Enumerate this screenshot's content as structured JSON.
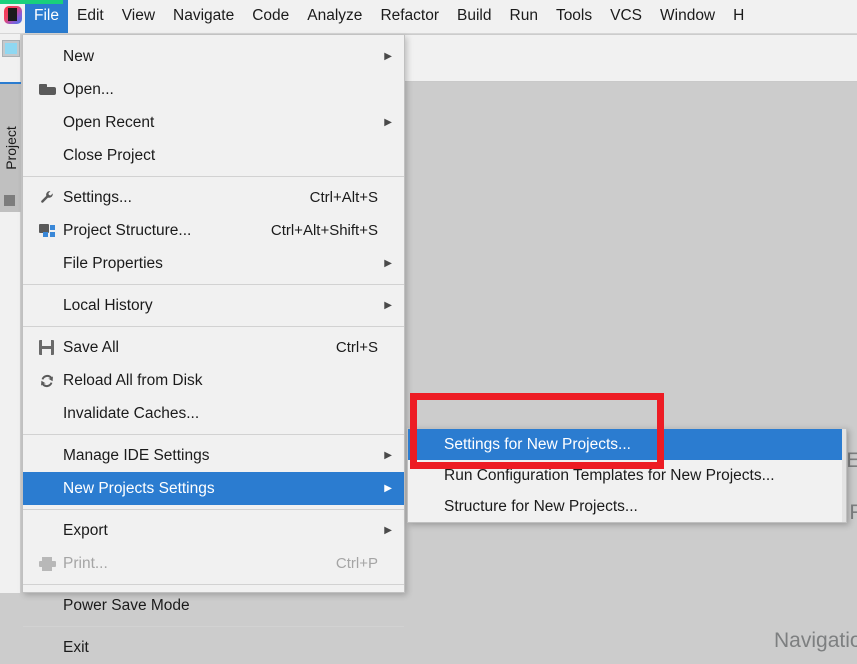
{
  "app": {
    "icon_name": "intellij-idea-icon",
    "accent_blue": "#2b7cd0",
    "annotation_red": "#ed1c24",
    "green_strip": "#19d07c",
    "background_gray": "#cccccc",
    "menu_background": "#f1f1f1"
  },
  "menubar": {
    "items": [
      {
        "label": "File",
        "active": true
      },
      {
        "label": "Edit",
        "active": false
      },
      {
        "label": "View",
        "active": false
      },
      {
        "label": "Navigate",
        "active": false
      },
      {
        "label": "Code",
        "active": false
      },
      {
        "label": "Analyze",
        "active": false
      },
      {
        "label": "Refactor",
        "active": false
      },
      {
        "label": "Build",
        "active": false
      },
      {
        "label": "Run",
        "active": false
      },
      {
        "label": "Tools",
        "active": false
      },
      {
        "label": "VCS",
        "active": false
      },
      {
        "label": "Window",
        "active": false
      },
      {
        "label": "H",
        "active": false
      }
    ]
  },
  "sidebar": {
    "project_tab_label": "Project"
  },
  "file_menu": {
    "items": [
      {
        "label": "New",
        "shortcut": "",
        "icon": "",
        "arrow": true,
        "selected": false,
        "disabled": false
      },
      {
        "label": "Open...",
        "shortcut": "",
        "icon": "folder-icon",
        "arrow": false,
        "selected": false,
        "disabled": false
      },
      {
        "label": "Open Recent",
        "shortcut": "",
        "icon": "",
        "arrow": true,
        "selected": false,
        "disabled": false
      },
      {
        "label": "Close Project",
        "shortcut": "",
        "icon": "",
        "arrow": false,
        "selected": false,
        "disabled": false
      },
      {
        "separator": true
      },
      {
        "label": "Settings...",
        "shortcut": "Ctrl+Alt+S",
        "icon": "wrench-icon",
        "arrow": false,
        "selected": false,
        "disabled": false
      },
      {
        "label": "Project Structure...",
        "shortcut": "Ctrl+Alt+Shift+S",
        "icon": "structure-icon",
        "arrow": false,
        "selected": false,
        "disabled": false
      },
      {
        "label": "File Properties",
        "shortcut": "",
        "icon": "",
        "arrow": true,
        "selected": false,
        "disabled": false
      },
      {
        "separator": true
      },
      {
        "label": "Local History",
        "shortcut": "",
        "icon": "",
        "arrow": true,
        "selected": false,
        "disabled": false
      },
      {
        "separator": true
      },
      {
        "label": "Save All",
        "shortcut": "Ctrl+S",
        "icon": "save-icon",
        "arrow": false,
        "selected": false,
        "disabled": false
      },
      {
        "label": "Reload All from Disk",
        "shortcut": "",
        "icon": "reload-icon",
        "arrow": false,
        "selected": false,
        "disabled": false
      },
      {
        "label": "Invalidate Caches...",
        "shortcut": "",
        "icon": "",
        "arrow": false,
        "selected": false,
        "disabled": false
      },
      {
        "separator": true
      },
      {
        "label": "Manage IDE Settings",
        "shortcut": "",
        "icon": "",
        "arrow": true,
        "selected": false,
        "disabled": false
      },
      {
        "label": "New Projects Settings",
        "shortcut": "",
        "icon": "",
        "arrow": true,
        "selected": true,
        "disabled": false
      },
      {
        "separator": true
      },
      {
        "label": "Export",
        "shortcut": "",
        "icon": "",
        "arrow": true,
        "selected": false,
        "disabled": false
      },
      {
        "label": "Print...",
        "shortcut": "Ctrl+P",
        "icon": "print-icon",
        "arrow": false,
        "selected": false,
        "disabled": true
      },
      {
        "separator": true
      },
      {
        "label": "Power Save Mode",
        "shortcut": "",
        "icon": "",
        "arrow": false,
        "selected": false,
        "disabled": false
      },
      {
        "separator": true
      },
      {
        "label": "Exit",
        "shortcut": "",
        "icon": "",
        "arrow": false,
        "selected": false,
        "disabled": false
      }
    ]
  },
  "submenu": {
    "title": "New Projects Settings",
    "items": [
      {
        "label": "Settings for New Projects...",
        "selected": true
      },
      {
        "label": "Run Configuration Templates for New Projects...",
        "selected": false
      },
      {
        "label": "Structure for New Projects...",
        "selected": false
      }
    ]
  },
  "welcome_hints": {
    "search": "Search E",
    "recent": "Recent Fil",
    "navigation": "Navigatio"
  },
  "annotation": {
    "shape": "rectangle",
    "color": "#ed1c24",
    "target": "Settings for New Projects..."
  }
}
